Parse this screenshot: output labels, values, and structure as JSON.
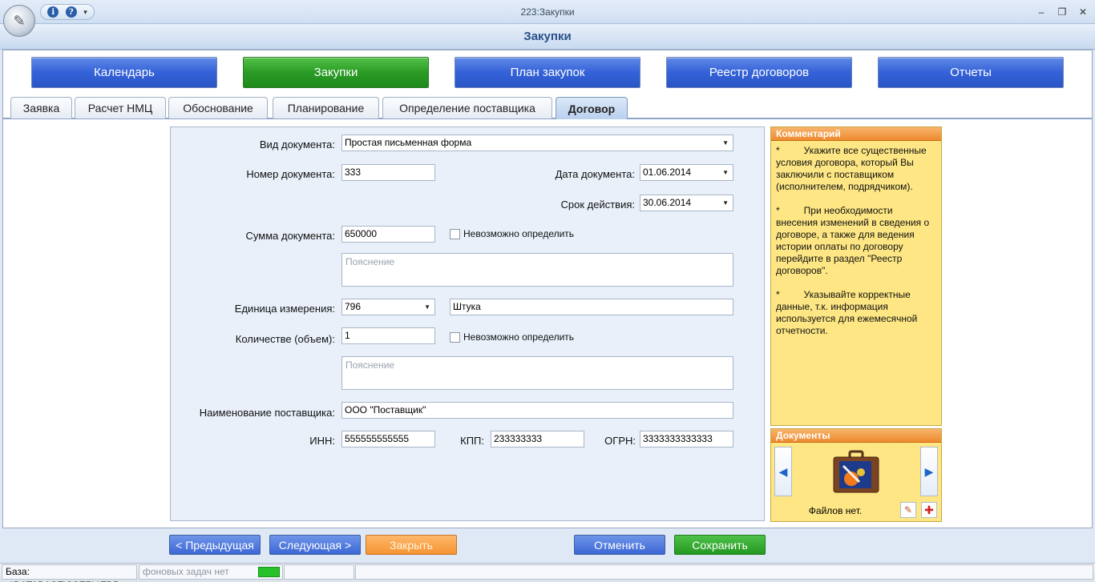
{
  "window": {
    "title": "223:Закупки",
    "minimize": "–",
    "restore": "❐",
    "close": "✕"
  },
  "qat": {
    "info_icon": "i",
    "help_icon": "?",
    "dropdown": "▾"
  },
  "header": {
    "title": "Закупки"
  },
  "nav": [
    {
      "label": "Календарь"
    },
    {
      "label": "Закупки"
    },
    {
      "label": "План закупок"
    },
    {
      "label": "Реестр договоров"
    },
    {
      "label": "Отчеты"
    }
  ],
  "tabs": [
    {
      "label": "Заявка"
    },
    {
      "label": "Расчет НМЦ"
    },
    {
      "label": "Обоснование"
    },
    {
      "label": "Планирование"
    },
    {
      "label": "Определение поставщика"
    },
    {
      "label": "Договор"
    }
  ],
  "form": {
    "doc_type_label": "Вид документа:",
    "doc_type_value": "Простая письменная форма",
    "doc_number_label": "Номер документа:",
    "doc_number_value": "333",
    "doc_date_label": "Дата документа:",
    "doc_date_value": "01.06.2014",
    "validity_label": "Срок действия:",
    "validity_value": "30.06.2014",
    "sum_label": "Сумма документа:",
    "sum_value": "650000",
    "sum_undetermined": "Невозможно определить",
    "sum_note_placeholder": "Пояснение",
    "unit_label": "Единица измерения:",
    "unit_code": "796",
    "unit_name": "Штука",
    "qty_label": "Количестве (объем):",
    "qty_value": "1",
    "qty_undetermined": "Невозможно определить",
    "qty_note_placeholder": "Пояснение",
    "supplier_label": "Наименование поставщика:",
    "supplier_value": "ООО \"Поставщик\"",
    "inn_label": "ИНН:",
    "inn_value": "555555555555",
    "kpp_label": "КПП:",
    "kpp_value": "233333333",
    "ogrn_label": "ОГРН:",
    "ogrn_value": "3333333333333"
  },
  "comment": {
    "title": "Комментарий",
    "text": "*         Укажите все существенные условия договора, который Вы заключили с поставщиком (исполнителем, подрядчиком).\n\n*         При необходимости внесения изменений в сведения о договоре, а также для ведения истории оплаты по договору перейдите в раздел \"Реестр договоров\".\n\n*         Указывайте корректные данные, т.к. информация используется для ежемесячной отчетности."
  },
  "documents": {
    "title": "Документы",
    "empty_text": "Файлов нет.",
    "prev": "◀",
    "next": "▶",
    "add": "✚"
  },
  "buttons": {
    "prev": "< Предыдущая",
    "next": "Следующая >",
    "close": "Закрыть",
    "cancel": "Отменить",
    "save": "Сохранить"
  },
  "status": {
    "base": "База: ..\\DATABASE\\SSERV.FDB",
    "tasks": "фоновых задач нет"
  },
  "colors": {
    "accent_blue": "#3462d8",
    "active_green": "#2a9b25",
    "comment_bg": "#fde683"
  }
}
